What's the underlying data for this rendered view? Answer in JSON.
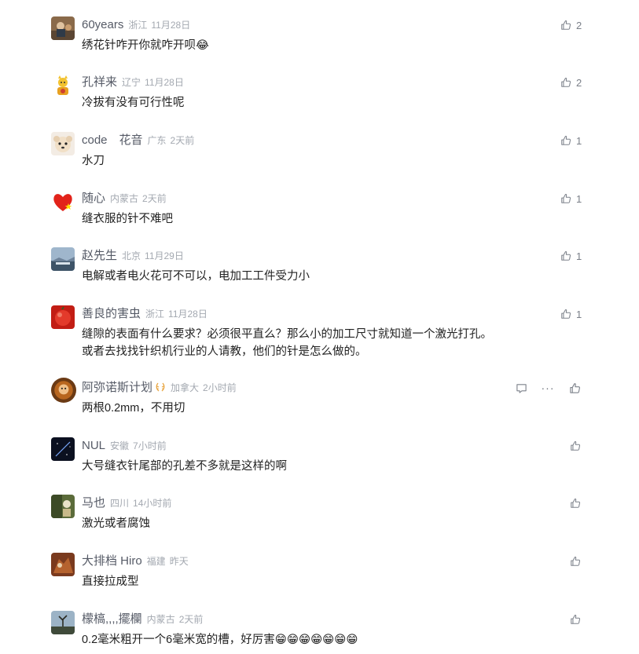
{
  "comments": [
    {
      "name": "60years",
      "location": "浙江",
      "time": "11月28日",
      "text": "绣花针咋开你就咋开呗😂",
      "likes": "2"
    },
    {
      "name": "孔祥来",
      "location": "辽宁",
      "time": "11月28日",
      "text": "冷拔有没有可行性呢",
      "likes": "2"
    },
    {
      "name": "code　花音",
      "location": "广东",
      "time": "2天前",
      "text": "水刀",
      "likes": "1"
    },
    {
      "name": "随心",
      "location": "内蒙古",
      "time": "2天前",
      "text": "缝衣服的针不难吧",
      "likes": "1"
    },
    {
      "name": "赵先生",
      "location": "北京",
      "time": "11月29日",
      "text": "电解或者电火花可不可以，电加工工件受力小",
      "likes": "1"
    },
    {
      "name": "善良的害虫",
      "location": "浙江",
      "time": "11月28日",
      "text_line1": "缝隙的表面有什么要求？必须很平直么？那么小的加工尺寸就知道一个激光打孔。",
      "text_line2": "或者去找找针织机行业的人请教，他们的针是怎么做的。",
      "likes": "1"
    },
    {
      "name": "阿弥诺斯计划",
      "location": "加拿大",
      "time": "2小时前",
      "text": "两根0.2mm，不用切"
    },
    {
      "name": "NUL",
      "location": "安徽",
      "time": "7小时前",
      "text": "大号缝衣针尾部的孔差不多就是这样的啊"
    },
    {
      "name": "马也",
      "location": "四川",
      "time": "14小时前",
      "text": "激光或者腐蚀"
    },
    {
      "name": "大排档 Hiro",
      "location": "福建",
      "time": "昨天",
      "text": "直接拉成型"
    },
    {
      "name": "檬槁,,,,擺欄",
      "location": "内蒙古",
      "time": "2天前",
      "text": "0.2毫米粗开一个6毫米宽的槽，好厉害😁😁😁😁😁😁😁"
    }
  ],
  "icons": {
    "like": "thumbs-up-icon",
    "reply": "comment-bubble-icon",
    "more": "more-dots-icon",
    "badge": "laurel-badge-icon"
  },
  "colors": {
    "name": "#555a66",
    "meta": "#a3a8b0",
    "text": "#222222",
    "badge": "#e8a33c"
  }
}
